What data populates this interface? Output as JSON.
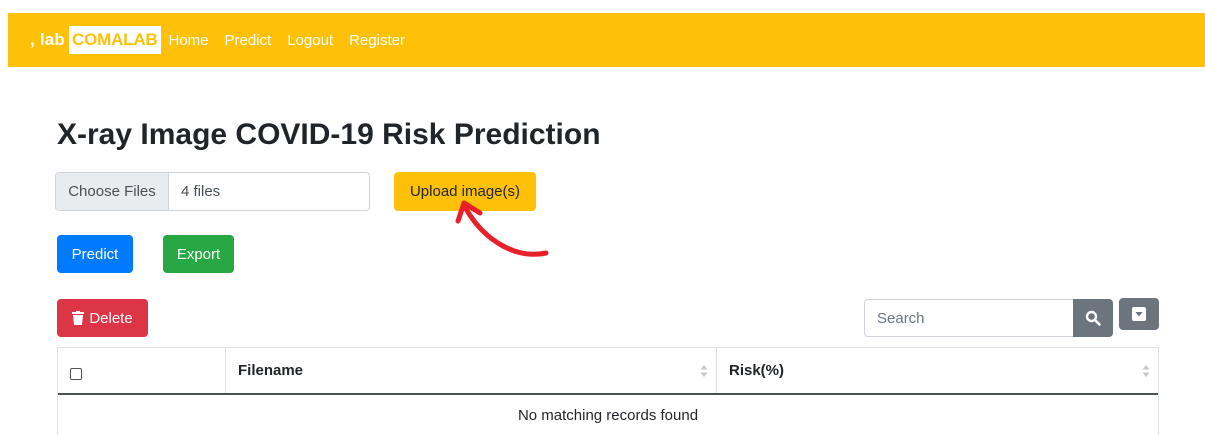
{
  "navbar": {
    "brand_prefix": ", lab",
    "brand_name": "COMALAB",
    "links": [
      "Home",
      "Predict",
      "Logout",
      "Register"
    ],
    "background": "#ffc107"
  },
  "page": {
    "title": "X-ray Image COVID-19 Risk Prediction"
  },
  "file_input": {
    "button_label": "Choose Files",
    "value": "4 files"
  },
  "buttons": {
    "upload": "Upload image(s)",
    "predict": "Predict",
    "export": "Export",
    "delete": "Delete"
  },
  "search": {
    "placeholder": "Search"
  },
  "table": {
    "columns": [
      "",
      "Filename",
      "Risk(%)"
    ],
    "empty_message": "No matching records found"
  },
  "icons": {
    "trash": "trash-icon",
    "search": "search-icon",
    "dropdown": "caret-down-icon",
    "sort": "sort-icon",
    "annotation_arrow": "red-curved-arrow"
  },
  "colors": {
    "warning": "#ffc107",
    "primary": "#007bff",
    "success": "#28a745",
    "danger": "#dc3545",
    "secondary": "#6c757d",
    "annotation": "#e8202a"
  }
}
